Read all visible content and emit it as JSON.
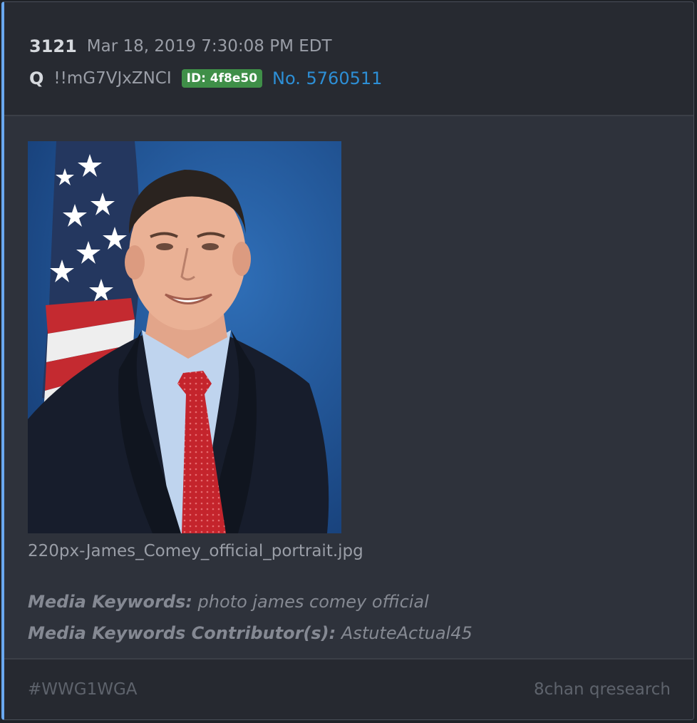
{
  "post": {
    "number": "3121",
    "date": "Mar 18, 2019 7:30:08 PM EDT",
    "author": "Q",
    "tripcode": "!!mG7VJxZNCI",
    "id_badge": "ID: 4f8e50",
    "post_link": "No. 5760511"
  },
  "media": {
    "filename": "220px-James_Comey_official_portrait.jpg",
    "keywords_label": "Media Keywords:",
    "keywords_value": "photo james comey official",
    "contributors_label": "Media Keywords Contributor(s):",
    "contributors_value": "AstuteActual45"
  },
  "footer": {
    "hashtag": "#WWG1WGA",
    "source": "8chan qresearch"
  },
  "colors": {
    "accent_left_border": "#6aa8ef",
    "id_badge_bg": "#3f8f48",
    "link": "#2d8fd6",
    "card_bg": "#2e323b"
  }
}
